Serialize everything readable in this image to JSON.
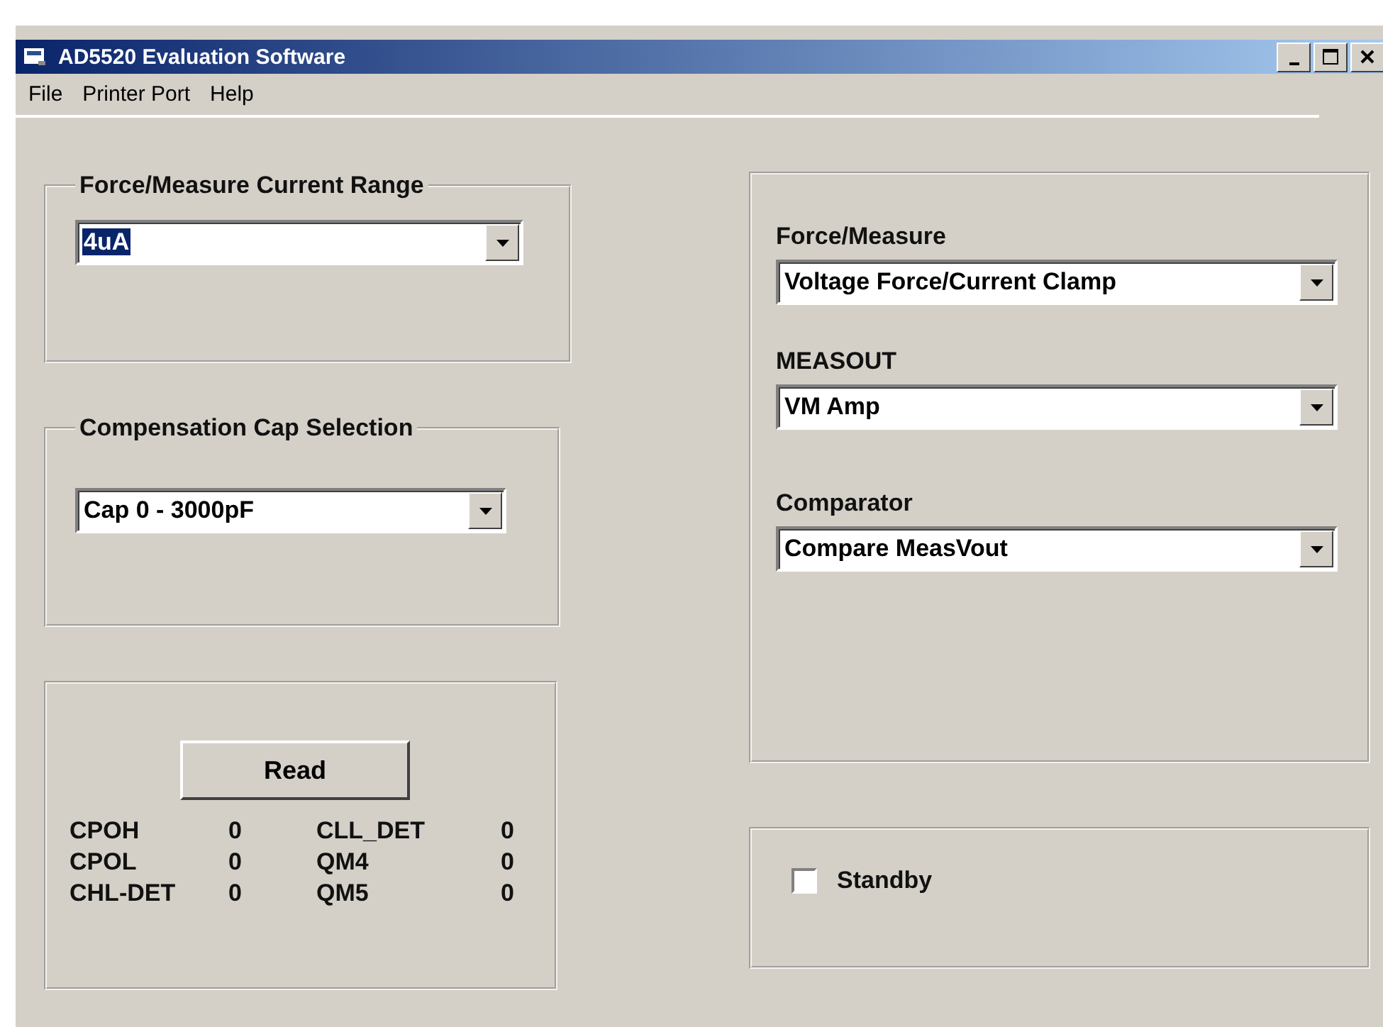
{
  "window": {
    "title": "AD5520 Evaluation Software"
  },
  "menu": [
    "File",
    "Printer Port",
    "Help"
  ],
  "current_range": {
    "legend": "Force/Measure Current Range",
    "value": "4uA",
    "text_selected": true
  },
  "comp_cap": {
    "legend": "Compensation Cap Selection",
    "value": "Cap 0 - 3000pF",
    "text_selected": false
  },
  "readback": {
    "button": "Read",
    "flags": [
      {
        "label": "CPOH",
        "value": "0"
      },
      {
        "label": "CLL_DET",
        "value": "0"
      },
      {
        "label": "CPOL",
        "value": "0"
      },
      {
        "label": "QM4",
        "value": "0"
      },
      {
        "label": "CHL-DET",
        "value": "0"
      },
      {
        "label": "QM5",
        "value": "0"
      }
    ]
  },
  "modes": [
    {
      "label": "Force/Measure",
      "value": "Voltage Force/Current Clamp"
    },
    {
      "label": "MEASOUT",
      "value": "VM Amp"
    },
    {
      "label": "Comparator",
      "value": "Compare MeasVout"
    }
  ],
  "standby": {
    "label": "Standby",
    "checked": false
  }
}
